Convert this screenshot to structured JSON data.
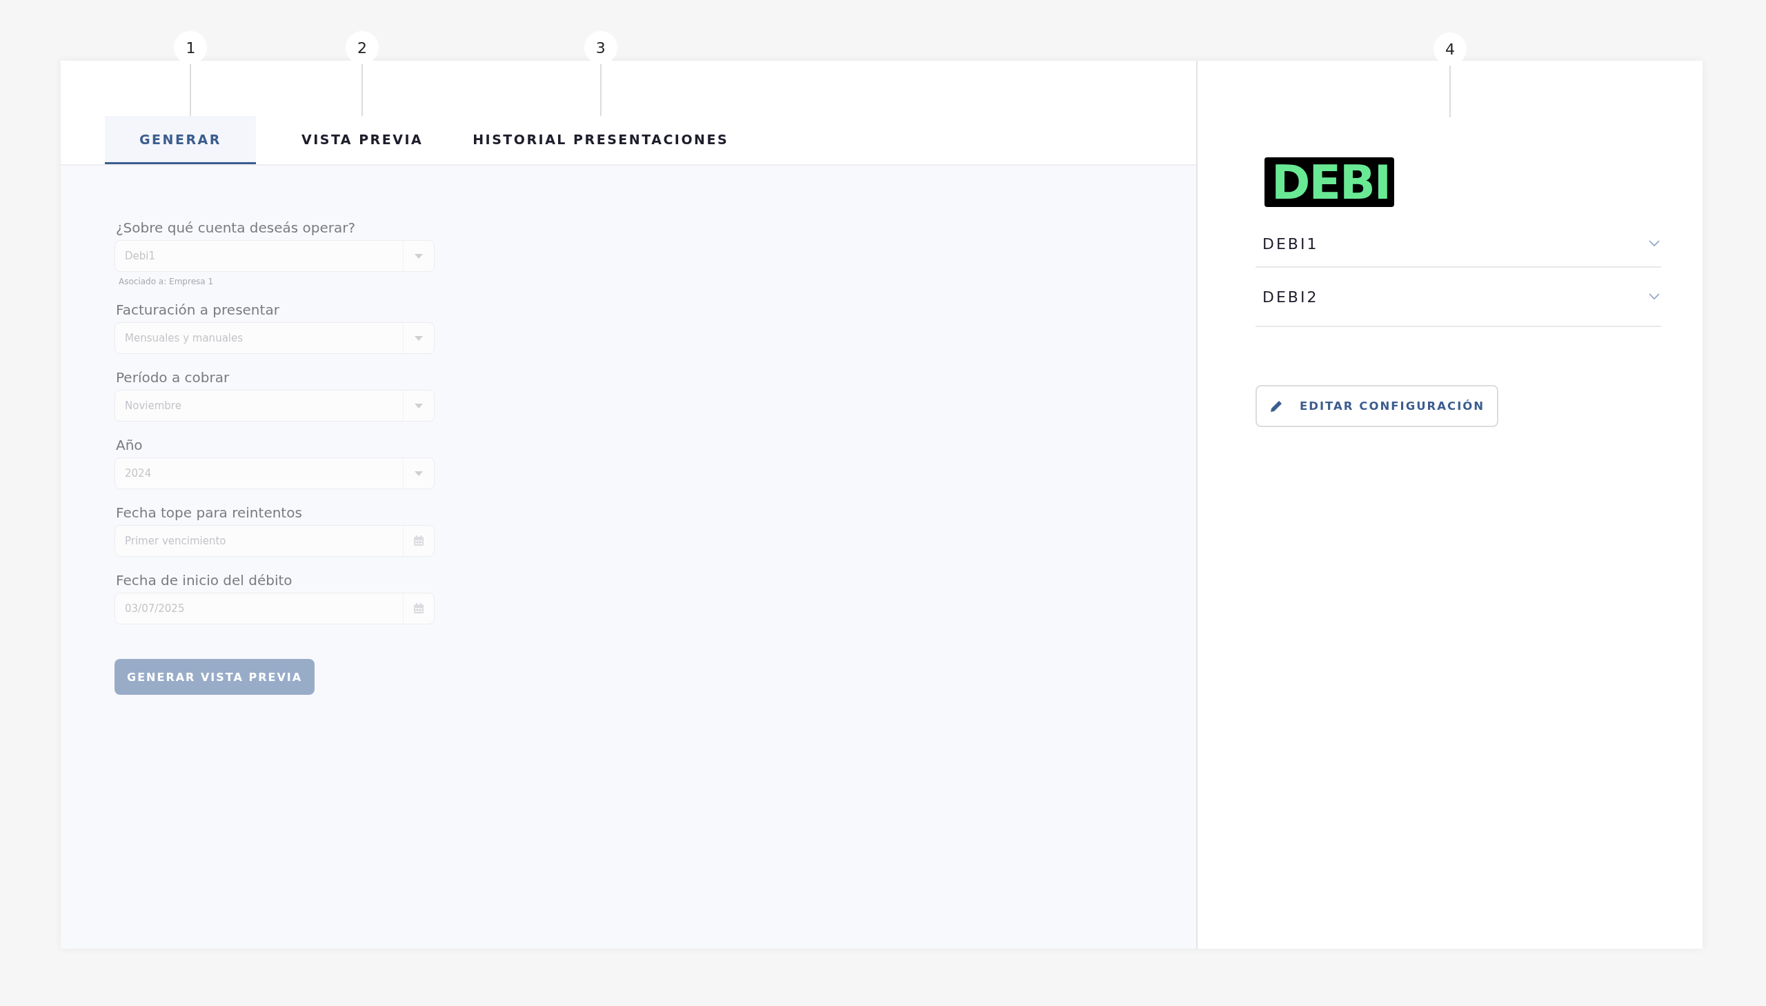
{
  "tabs": [
    {
      "label": "GENERAR",
      "selected": true,
      "callout": "1"
    },
    {
      "label": "VISTA PREVIA",
      "selected": false,
      "callout": "2"
    },
    {
      "label": "HISTORIAL PRESENTACIONES",
      "selected": false,
      "callout": "3"
    }
  ],
  "form": {
    "fields": [
      {
        "kind": "select",
        "label": "¿Sobre qué cuenta deseás operar?",
        "value": "Debi1",
        "hint": "Asociado a: Empresa 1",
        "disabled": true
      },
      {
        "kind": "select",
        "label": "Facturación a presentar",
        "value": "Mensuales y manuales",
        "disabled": true
      },
      {
        "kind": "select",
        "label": "Período a cobrar",
        "value": "Noviembre",
        "disabled": true
      },
      {
        "kind": "select",
        "label": "Año",
        "value": "2024",
        "disabled": true
      },
      {
        "kind": "date",
        "label": "Fecha tope para reintentos",
        "placeholder": "Primer vencimiento",
        "disabled": true
      },
      {
        "kind": "date",
        "label": "Fecha de inicio del débito",
        "value": "03/07/2025",
        "disabled": true
      }
    ],
    "generate_button": {
      "label": "GENERAR VISTA PREVIA",
      "disabled": true
    }
  },
  "side": {
    "callout": "4",
    "logo": "DEBI",
    "accounts": [
      {
        "name": "DEBI1",
        "expanded": false
      },
      {
        "name": "DEBI2",
        "expanded": false
      }
    ],
    "edit_button": "EDITAR CONFIGURACIÓN"
  }
}
